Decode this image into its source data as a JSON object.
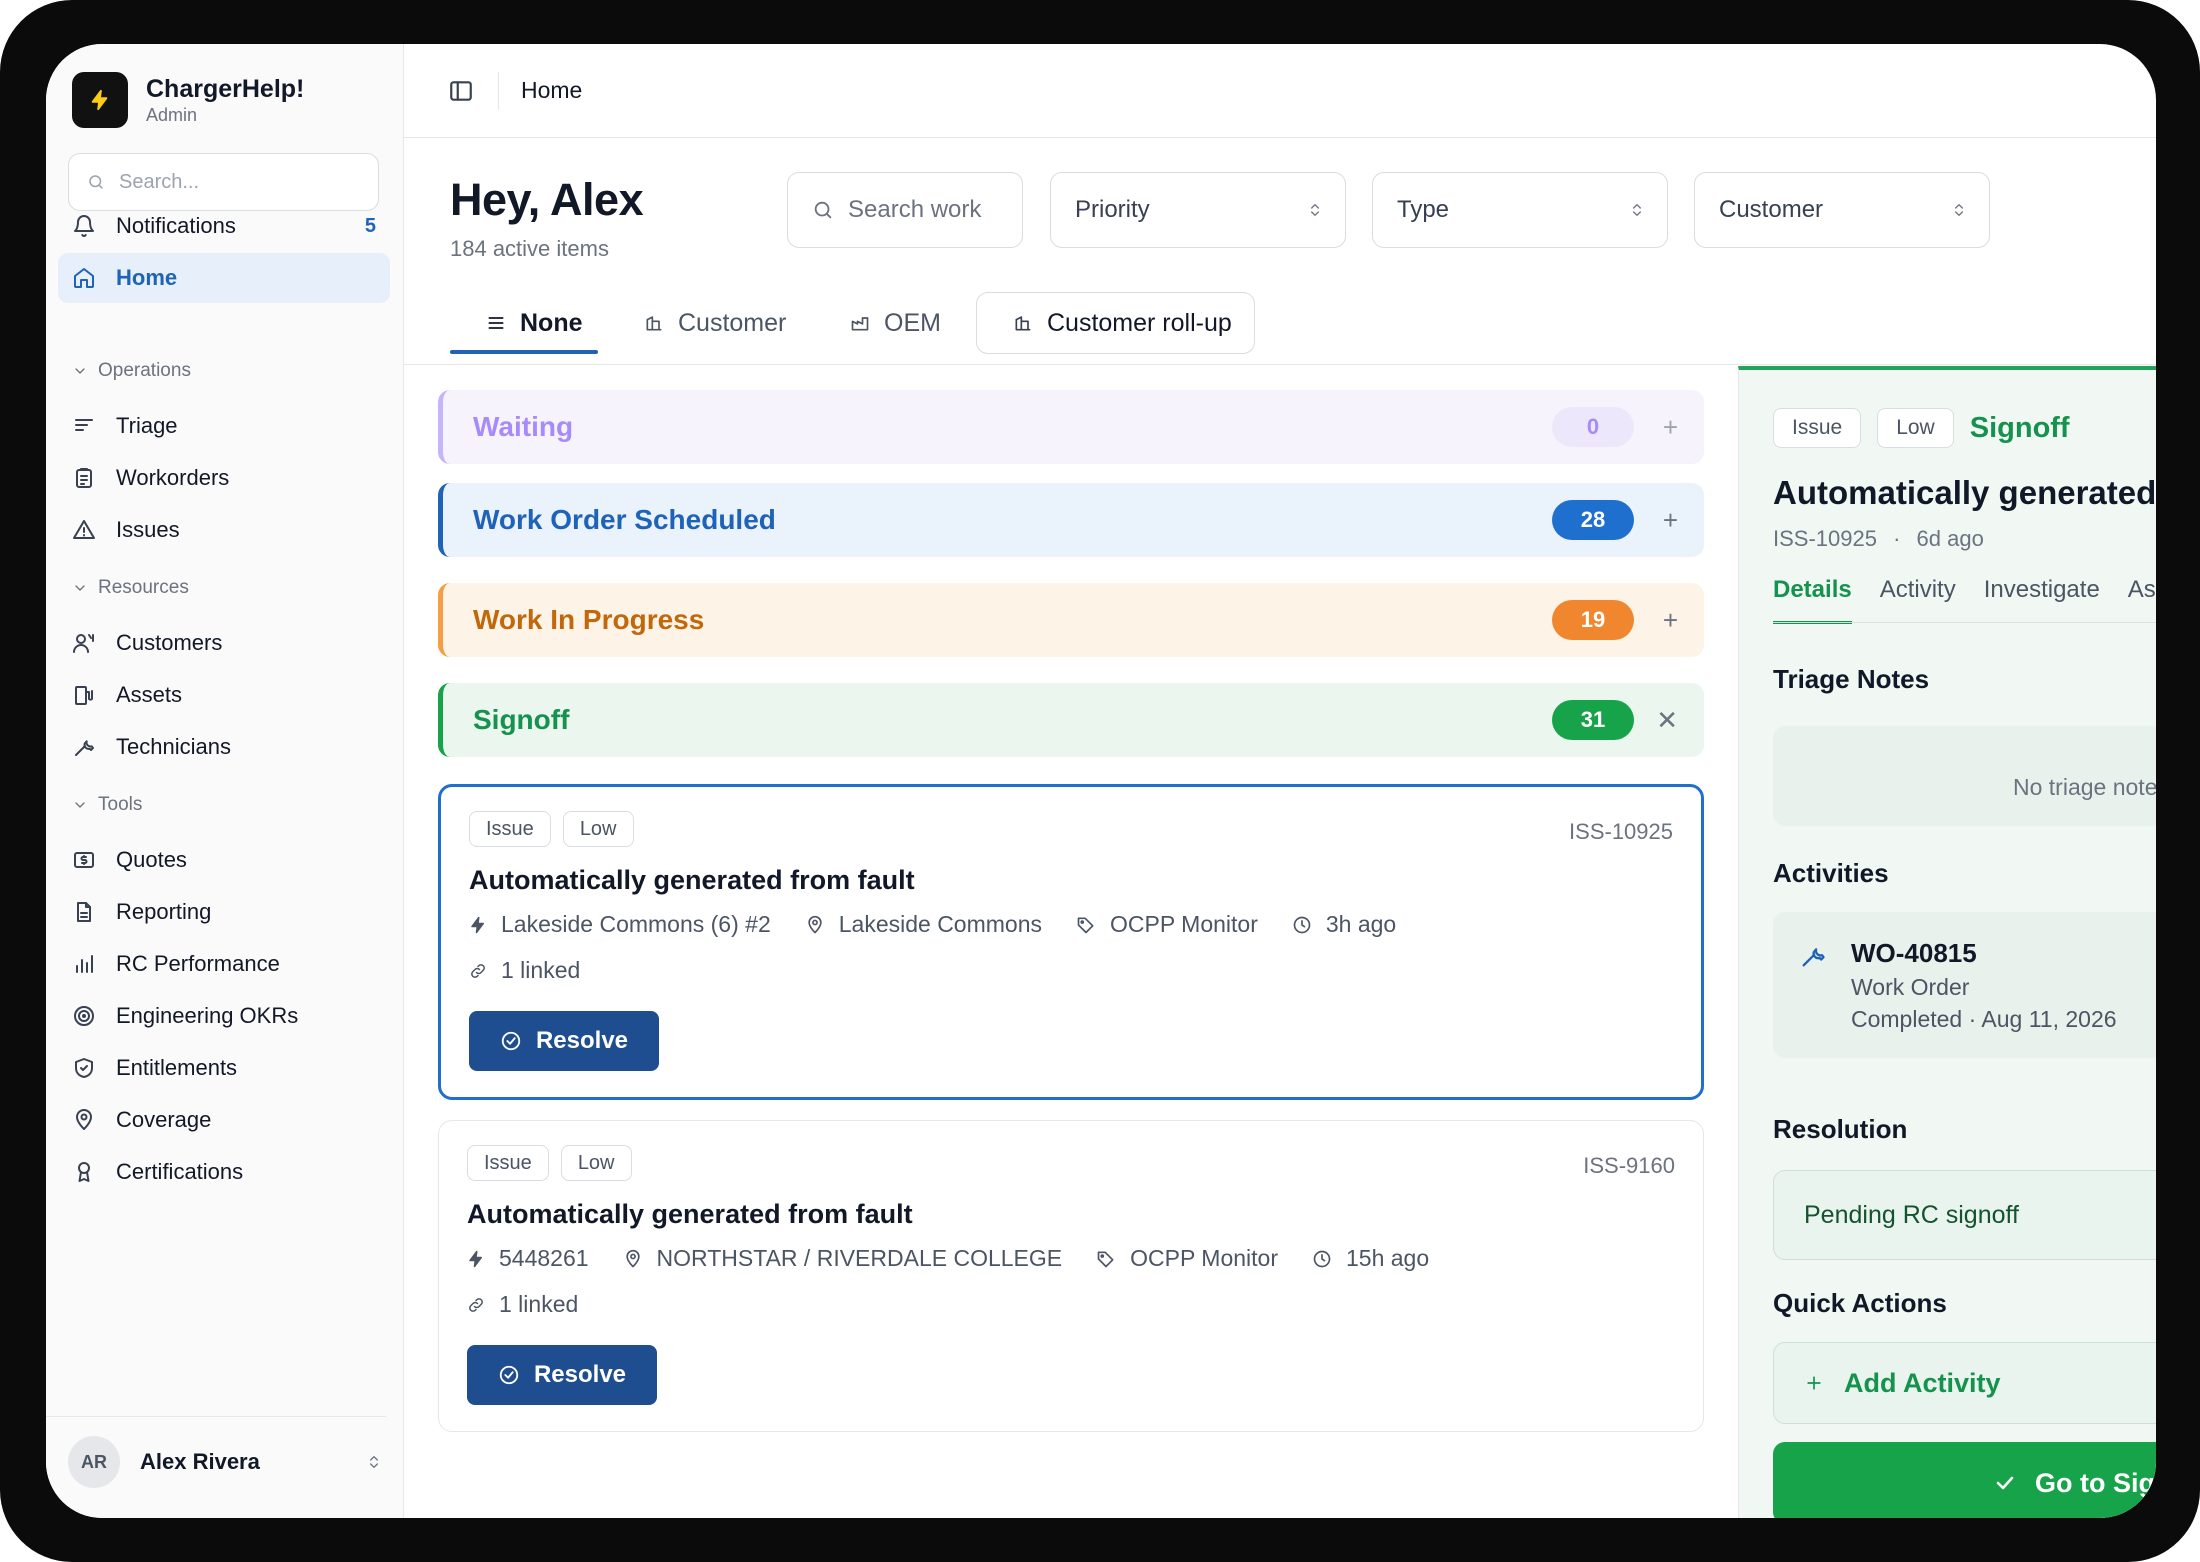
{
  "app": {
    "name": "ChargerHelp!",
    "role": "Admin"
  },
  "sidebar": {
    "search_placeholder": "Search...",
    "notifications": {
      "label": "Notifications",
      "count": "5"
    },
    "home": {
      "label": "Home"
    },
    "sections": [
      {
        "title": "Operations",
        "items": [
          "Triage",
          "Workorders",
          "Issues"
        ]
      },
      {
        "title": "Resources",
        "items": [
          "Customers",
          "Assets",
          "Technicians"
        ]
      },
      {
        "title": "Tools",
        "items": [
          "Quotes",
          "Reporting",
          "RC Performance",
          "Engineering OKRs",
          "Entitlements",
          "Coverage",
          "Certifications"
        ]
      }
    ],
    "user": {
      "initials": "AR",
      "name": "Alex Rivera"
    }
  },
  "topbar": {
    "breadcrumb": "Home"
  },
  "header": {
    "greeting": "Hey, Alex",
    "subtitle": "184 active items"
  },
  "filters": {
    "search_placeholder": "Search work",
    "priority": "Priority",
    "type": "Type",
    "customer": "Customer"
  },
  "group_tabs": [
    "None",
    "Customer",
    "OEM",
    "Customer roll-up"
  ],
  "groups": [
    {
      "name": "Waiting",
      "count": "0",
      "color": "#a78bfa"
    },
    {
      "name": "Work Order Scheduled",
      "count": "28",
      "color": "#1f63b8"
    },
    {
      "name": "Work In Progress",
      "count": "19",
      "color": "#c2680c"
    },
    {
      "name": "Signoff",
      "count": "31",
      "color": "#15924d"
    }
  ],
  "cards": [
    {
      "type": "Issue",
      "priority": "Low",
      "id": "ISS-10925",
      "title": "Automatically generated from fault",
      "charger": "Lakeside Commons (6) #2",
      "site": "Lakeside Commons",
      "source": "OCPP Monitor",
      "time": "3h ago",
      "linked": "1 linked",
      "action": "Resolve"
    },
    {
      "type": "Issue",
      "priority": "Low",
      "id": "ISS-9160",
      "title": "Automatically generated from fault",
      "charger": "5448261",
      "site": "NORTHSTAR / RIVERDALE COLLEGE",
      "source": "OCPP Monitor",
      "time": "15h ago",
      "linked": "1 linked",
      "action": "Resolve"
    }
  ],
  "detail": {
    "type": "Issue",
    "priority": "Low",
    "status": "Signoff",
    "title": "Automatically generated from fault",
    "id": "ISS-10925",
    "sep": "·",
    "age": "6d ago",
    "tabs": [
      "Details",
      "Activity",
      "Investigate",
      "Assets"
    ],
    "triage_heading": "Triage Notes",
    "triage_empty": "No triage notes",
    "activities_heading": "Activities",
    "activity": {
      "id": "WO-40815",
      "kind": "Work Order",
      "status": "Completed · Aug 11, 2026"
    },
    "resolution_heading": "Resolution",
    "resolution": "Pending RC signoff",
    "quick_heading": "Quick Actions",
    "add_activity": "Add Activity",
    "go_signoff": "Go to Signoff"
  }
}
